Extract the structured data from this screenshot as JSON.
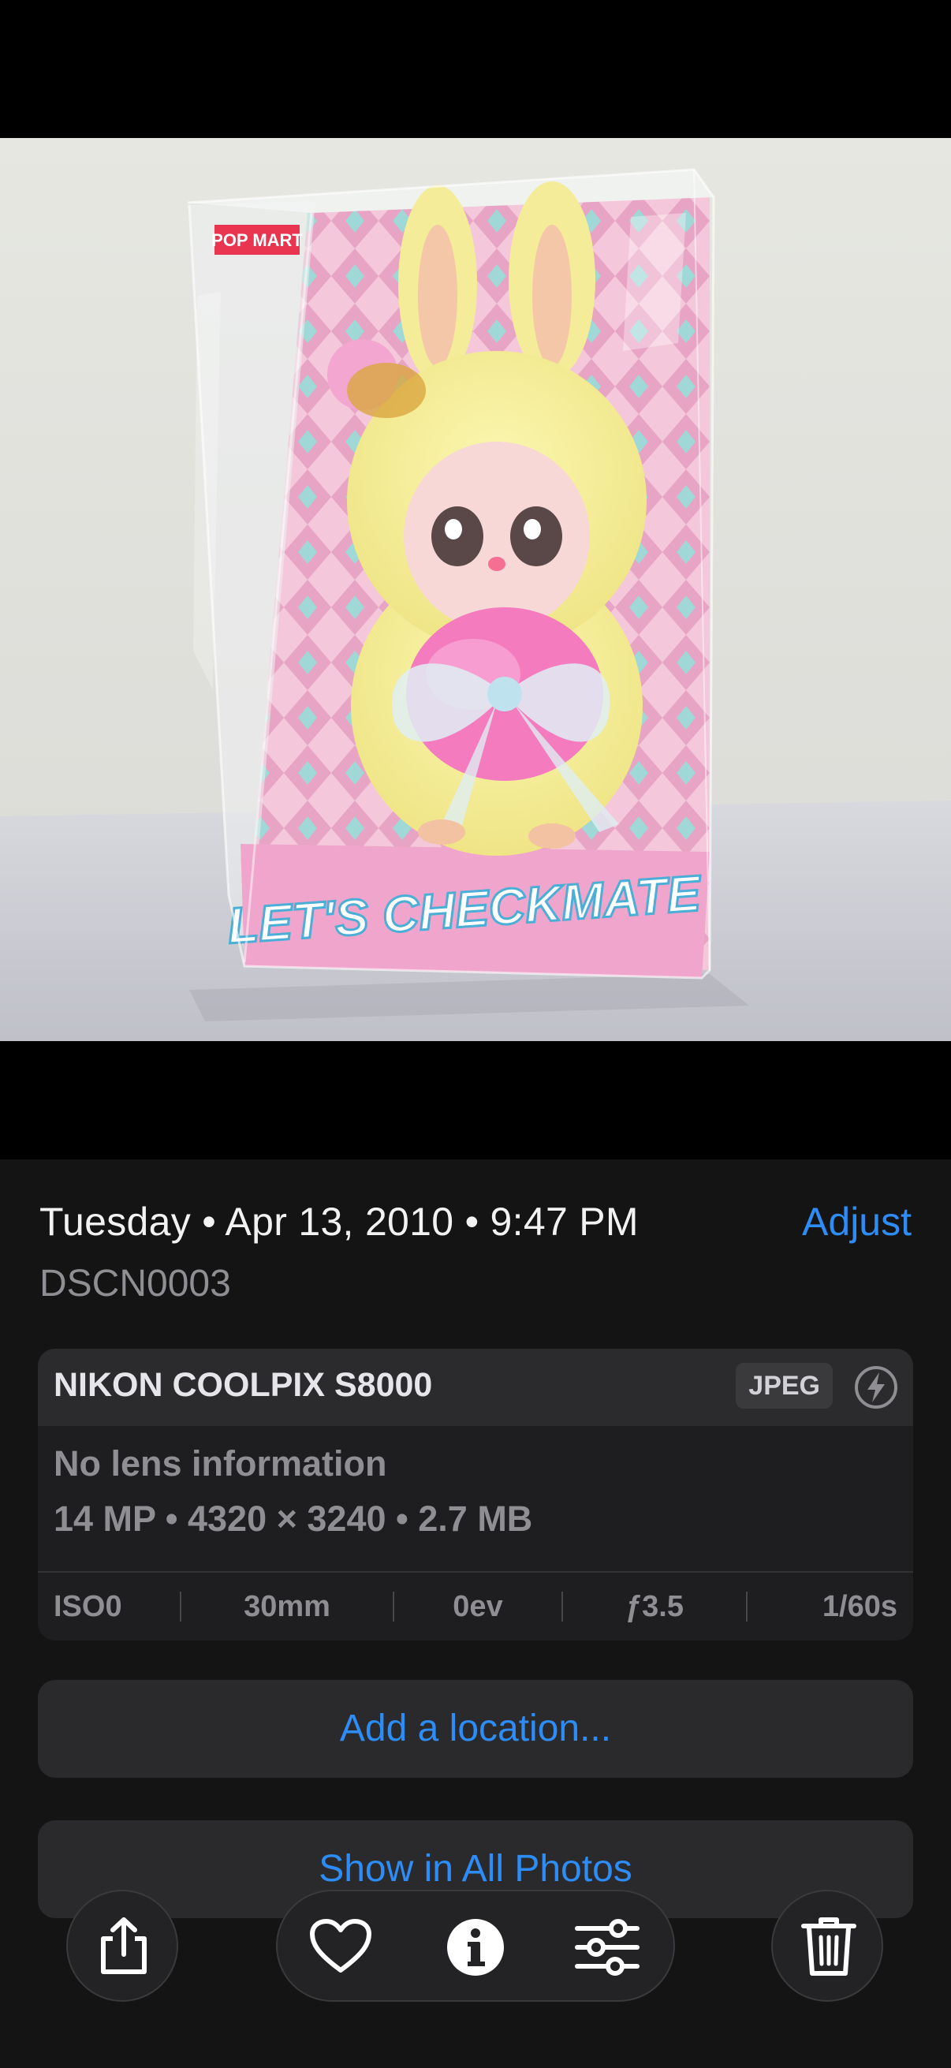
{
  "photo": {
    "brand_label": "POP MART",
    "box_title": "LET'S CHECKMATE"
  },
  "info": {
    "date_line": "Tuesday • Apr 13, 2010 • 9:47 PM",
    "adjust_label": "Adjust",
    "filename": "DSCN0003"
  },
  "camera": {
    "model": "NIKON COOLPIX S8000",
    "format": "JPEG",
    "lens": "No lens information",
    "specs": "14 MP • 4320 × 3240 • 2.7 MB",
    "exif": {
      "iso": "ISO0",
      "focal_length": "30mm",
      "exposure_bias": "0ev",
      "aperture": "ƒ3.5",
      "shutter": "1/60s"
    }
  },
  "actions": {
    "add_location": "Add a location...",
    "show_all": "Show in All Photos"
  },
  "toolbar": {
    "share_icon": "share-icon",
    "favorite_icon": "heart-icon",
    "info_icon": "info-icon",
    "edit_icon": "sliders-icon",
    "delete_icon": "trash-icon"
  },
  "colors": {
    "accent": "#2d8cf5",
    "panel_bg": "#141414",
    "card_bg": "#1e1e20"
  }
}
